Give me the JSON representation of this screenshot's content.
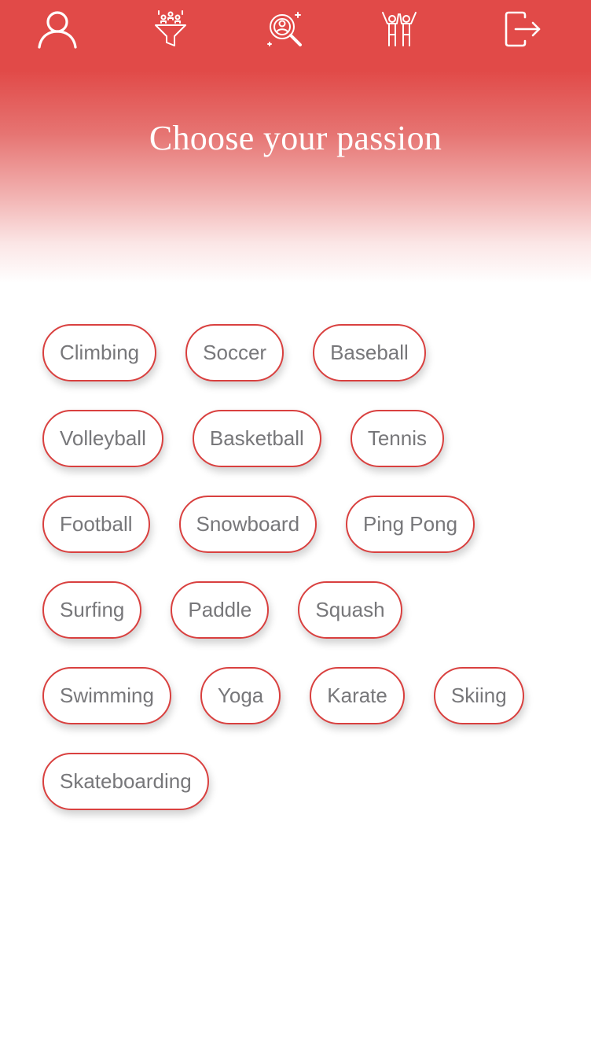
{
  "nav": {
    "icons": [
      "user-icon",
      "filter-icon",
      "search-person-icon",
      "friends-celebrate-icon",
      "logout-icon"
    ]
  },
  "colors": {
    "accent": "#e14a48",
    "chip_border": "#d9403f",
    "chip_text": "#77777a",
    "background": "#ffffff"
  },
  "title": "Choose your passion",
  "passions": [
    [
      "Climbing",
      "Soccer",
      "Baseball"
    ],
    [
      "Volleyball",
      "Basketball",
      "Tennis"
    ],
    [
      "Football",
      "Snowboard",
      "Ping Pong"
    ],
    [
      "Surfing",
      "Paddle",
      "Squash"
    ],
    [
      "Swimming",
      "Yoga",
      "Karate",
      "Skiing"
    ],
    [
      "Skateboarding"
    ]
  ]
}
